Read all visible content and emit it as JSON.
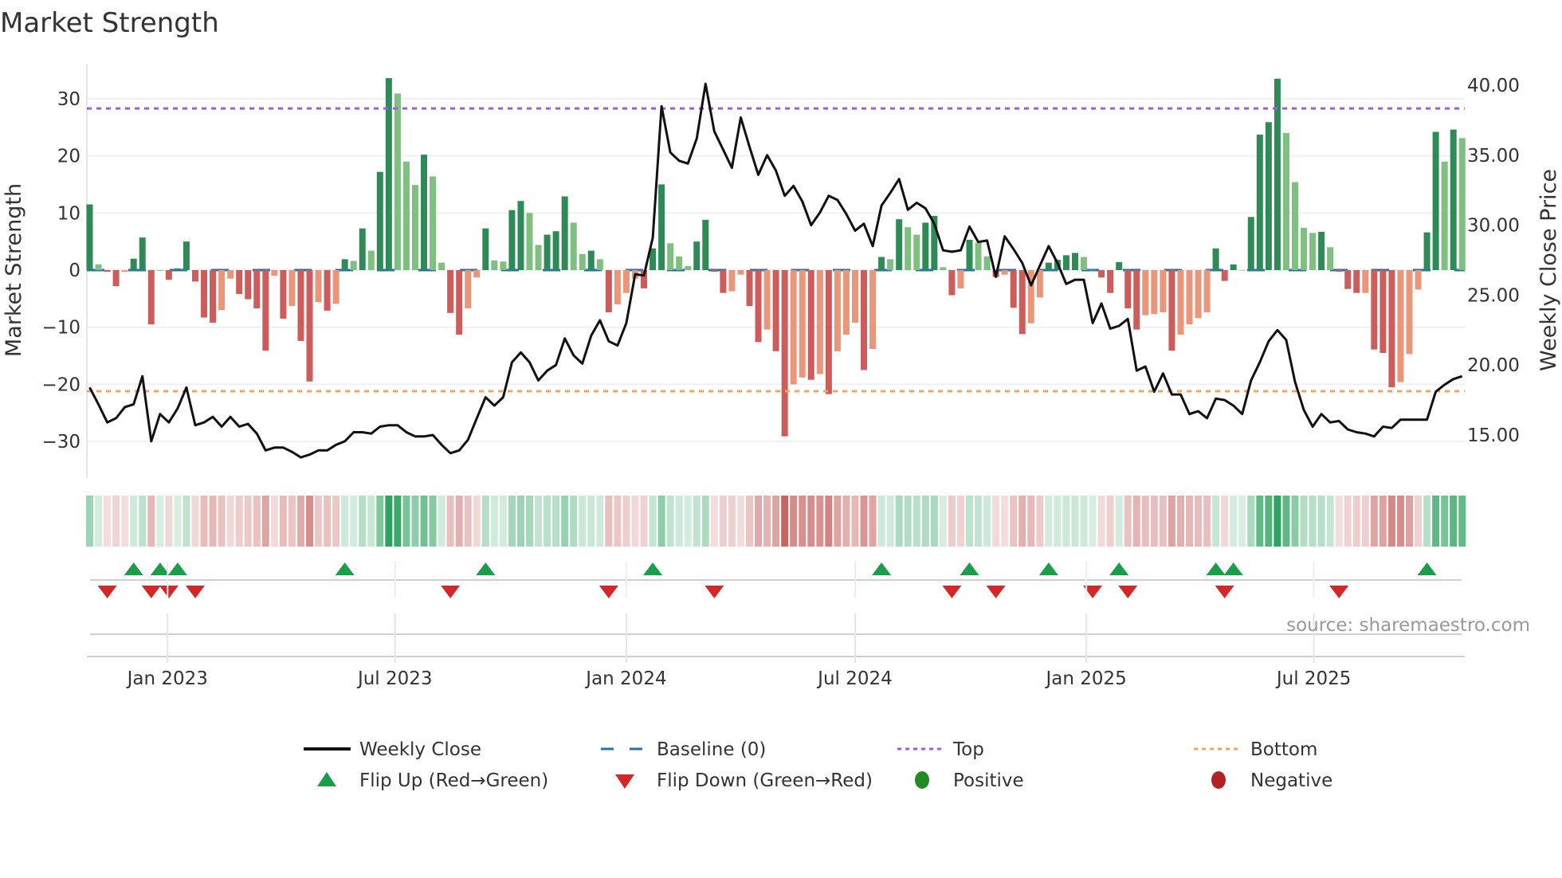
{
  "title": "Market Strength",
  "source": "source: sharemaestro.com",
  "colors": {
    "strong_up": "#2e8b57",
    "weak_up": "#7fbf7f",
    "strong_down": "#cd5c5c",
    "weak_down": "#e9967a",
    "top": "#9b5de5",
    "bottom": "#f4a460",
    "baseline": "#2a6fa8",
    "close": "#111111",
    "flip_up": "#1a9e4a",
    "flip_down": "#d62728",
    "positive": "#228b22",
    "negative": "#b22222",
    "heat_pos": "#2ca25f",
    "heat_neg": "#c0504d"
  },
  "legend": {
    "weekly_close": "Weekly Close",
    "baseline": "Baseline (0)",
    "top": "Top",
    "bottom": "Bottom",
    "flip_up": "Flip Up (Red→Green)",
    "flip_down": "Flip Down (Green→Red)",
    "positive": "Positive",
    "negative": "Negative"
  },
  "chart_data": {
    "type": "bar",
    "title": "Market Strength",
    "ylabel": "Market Strength",
    "y2label": "Weekly Close Price",
    "ylim": [
      -37,
      37
    ],
    "y2lim": [
      12.5,
      42
    ],
    "yticks": [
      30,
      20,
      10,
      0,
      -10,
      -20,
      -30
    ],
    "ytick_labels": [
      "30",
      "20",
      "10",
      "0",
      "−10",
      "−20",
      "−30"
    ],
    "y2ticks": [
      40,
      35,
      30,
      25,
      20,
      15
    ],
    "y2tick_labels": [
      "40.00",
      "35.00",
      "30.00",
      "25.00",
      "20.00",
      "15.00"
    ],
    "x_start_date": "2022-10-31",
    "x_interval_days": 7,
    "xticks": [
      {
        "date": "2023-01-01",
        "label": "Jan 2023"
      },
      {
        "date": "2023-07-01",
        "label": "Jul 2023"
      },
      {
        "date": "2024-01-01",
        "label": "Jan 2024"
      },
      {
        "date": "2024-07-01",
        "label": "Jul 2024"
      },
      {
        "date": "2025-01-01",
        "label": "Jan 2025"
      },
      {
        "date": "2025-07-01",
        "label": "Jul 2025"
      }
    ],
    "top_level": 28.3,
    "bottom_level": -21.2,
    "baseline": 0,
    "strength": [
      11.5,
      1,
      -0.3,
      -2.8,
      -0.3,
      2,
      5.7,
      -9.5,
      0,
      -1.7,
      0.3,
      5,
      -2,
      -8.3,
      -9.2,
      -7,
      -1.5,
      -4.2,
      -5.1,
      -6.7,
      -14.1,
      -1,
      -8.5,
      -6.3,
      -12.4,
      -19.5,
      -5.6,
      -7.1,
      -5.9,
      1.9,
      1.6,
      7.3,
      3.4,
      17.2,
      33.6,
      30.9,
      19,
      14.9,
      20.2,
      16.4,
      1.3,
      -7.5,
      -11.3,
      -6.7,
      -1.3,
      7.3,
      1.7,
      1.5,
      10.5,
      12.1,
      10,
      4.4,
      6.2,
      6.8,
      12.9,
      8.3,
      2.8,
      3.4,
      1.9,
      -7.4,
      -6,
      -4,
      -1.5,
      -3.2,
      3.8,
      15,
      4.7,
      2.4,
      0.7,
      5,
      8.8,
      -0.3,
      -4,
      -3.7,
      -0.8,
      -6.3,
      -12.6,
      -10.4,
      -14.2,
      -29.1,
      -20,
      -18.8,
      -19.2,
      -18.2,
      -21.7,
      -14.2,
      -11.3,
      -9.2,
      -17.5,
      -13.8,
      2.3,
      1.9,
      8.9,
      7.5,
      6.2,
      8.3,
      9.5,
      0.5,
      -4.4,
      -3.2,
      5.3,
      4.8,
      2.4,
      -1.2,
      -0.8,
      -6.6,
      -11.2,
      -9.3,
      -4.8,
      1.3,
      1.8,
      2.6,
      3,
      2.3,
      0,
      -1.3,
      -4,
      1.4,
      -6.7,
      -10.4,
      -7.9,
      -7.7,
      -7.4,
      -14.1,
      -11.3,
      -9.5,
      -8.4,
      -7.4,
      3.8,
      -1.9,
      1,
      0,
      9.3,
      23.7,
      25.9,
      33.5,
      24,
      15.4,
      7.4,
      6.5,
      6.7,
      4,
      -0.3,
      -3.3,
      -4,
      -4,
      -13.9,
      -14.5,
      -20.5,
      -19.6,
      -14.7,
      -3.4,
      6.6,
      24.2,
      19,
      24.6,
      23.1
    ],
    "weekly_close": [
      18.4,
      17.2,
      15.9,
      16.2,
      17.0,
      17.2,
      19.2,
      14.55,
      16.5,
      15.9,
      16.9,
      18.4,
      15.7,
      15.9,
      16.3,
      15.6,
      16.3,
      15.6,
      15.8,
      15.1,
      13.9,
      14.1,
      14.1,
      13.8,
      13.4,
      13.6,
      13.9,
      13.9,
      14.3,
      14.55,
      15.2,
      15.2,
      15.1,
      15.6,
      15.7,
      15.7,
      15.2,
      14.9,
      14.9,
      15.0,
      14.3,
      13.7,
      13.9,
      14.65,
      16.2,
      17.7,
      17.1,
      17.7,
      20.2,
      20.9,
      20.2,
      18.9,
      19.6,
      20.0,
      21.9,
      20.7,
      20.1,
      22.1,
      23.2,
      21.7,
      21.4,
      23.0,
      26.5,
      26.4,
      29.1,
      38.5,
      35.2,
      34.6,
      34.4,
      36.2,
      40.1,
      36.7,
      35.4,
      34.1,
      37.7,
      35.6,
      33.6,
      35.0,
      33.9,
      32.1,
      32.8,
      31.7,
      30.0,
      30.9,
      32.1,
      31.8,
      30.8,
      29.6,
      30.1,
      28.5,
      31.4,
      32.3,
      33.3,
      31.1,
      31.6,
      31.2,
      30.1,
      28.2,
      28.1,
      28.2,
      29.9,
      28.8,
      28.9,
      26.3,
      29.2,
      28.3,
      27.3,
      25.7,
      27.1,
      28.5,
      27.3,
      25.8,
      26.1,
      26.1,
      23.0,
      24.4,
      22.6,
      22.8,
      23.3,
      19.6,
      19.9,
      18.1,
      19.4,
      17.9,
      17.9,
      16.5,
      16.7,
      16.2,
      17.6,
      17.5,
      17.1,
      16.5,
      18.9,
      20.2,
      21.7,
      22.5,
      21.8,
      18.8,
      16.8,
      15.6,
      16.5,
      15.9,
      16.0,
      15.4,
      15.2,
      15.1,
      14.9,
      15.6,
      15.5,
      16.1,
      16.1,
      16.1,
      16.1,
      18.1,
      18.6,
      19.0,
      19.2
    ],
    "flip_up_weeks": [
      5,
      8,
      10,
      29,
      45,
      64,
      90,
      100,
      109,
      117,
      128,
      130,
      152
    ],
    "flip_down_weeks": [
      2,
      7,
      9,
      12,
      41,
      59,
      71,
      98,
      103,
      114,
      118,
      129,
      142
    ],
    "legend_placement": "bottom-center"
  }
}
